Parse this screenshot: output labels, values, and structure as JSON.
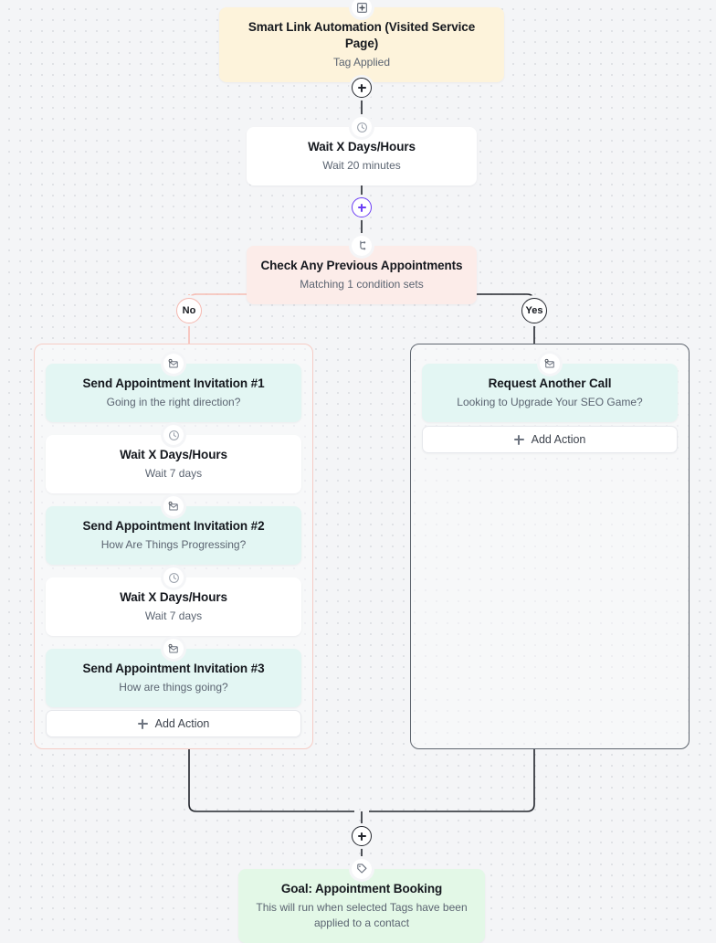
{
  "canvas": {
    "background_color": "#f4f5f7",
    "dot_color": "#dcdee3"
  },
  "colors": {
    "trigger_bg": "#fdf3db",
    "wait_bg": "#ffffff",
    "condition_bg": "#fcece9",
    "email_bg": "#e3f6f3",
    "goal_bg": "#e3f8e7",
    "edge_dark": "#23262d",
    "edge_pink": "#f7bdb4",
    "accent_purple": "#6b3df5"
  },
  "nodes": {
    "trigger": {
      "icon": "tag-plus-icon",
      "title": "Smart Link Automation (Visited Service Page)",
      "subtitle": "Tag Applied"
    },
    "wait_top": {
      "icon": "clock-icon",
      "title": "Wait X Days/Hours",
      "subtitle": "Wait 20 minutes"
    },
    "condition": {
      "icon": "branch-icon",
      "title": "Check Any Previous Appointments",
      "subtitle": "Matching 1 condition sets"
    },
    "no_branch": {
      "label": "No",
      "steps": [
        {
          "icon": "mail-person-icon",
          "title": "Send Appointment Invitation #1",
          "subtitle": "Going in the right direction?"
        },
        {
          "icon": "clock-icon",
          "title": "Wait X Days/Hours",
          "subtitle": "Wait 7 days"
        },
        {
          "icon": "mail-person-icon",
          "title": "Send Appointment Invitation #2",
          "subtitle": "How Are Things Progressing?"
        },
        {
          "icon": "clock-icon",
          "title": "Wait X Days/Hours",
          "subtitle": "Wait 7 days"
        },
        {
          "icon": "mail-person-icon",
          "title": "Send Appointment Invitation #3",
          "subtitle": "How are things going?"
        }
      ],
      "add_action_label": "Add Action"
    },
    "yes_branch": {
      "label": "Yes",
      "steps": [
        {
          "icon": "mail-person-icon",
          "title": "Request Another Call",
          "subtitle": "Looking to Upgrade Your SEO Game?"
        }
      ],
      "add_action_label": "Add Action"
    },
    "goal": {
      "icon": "tag-icon",
      "title": "Goal: Appointment Booking",
      "subtitle": "This will run when selected Tags have been applied to a contact"
    }
  }
}
